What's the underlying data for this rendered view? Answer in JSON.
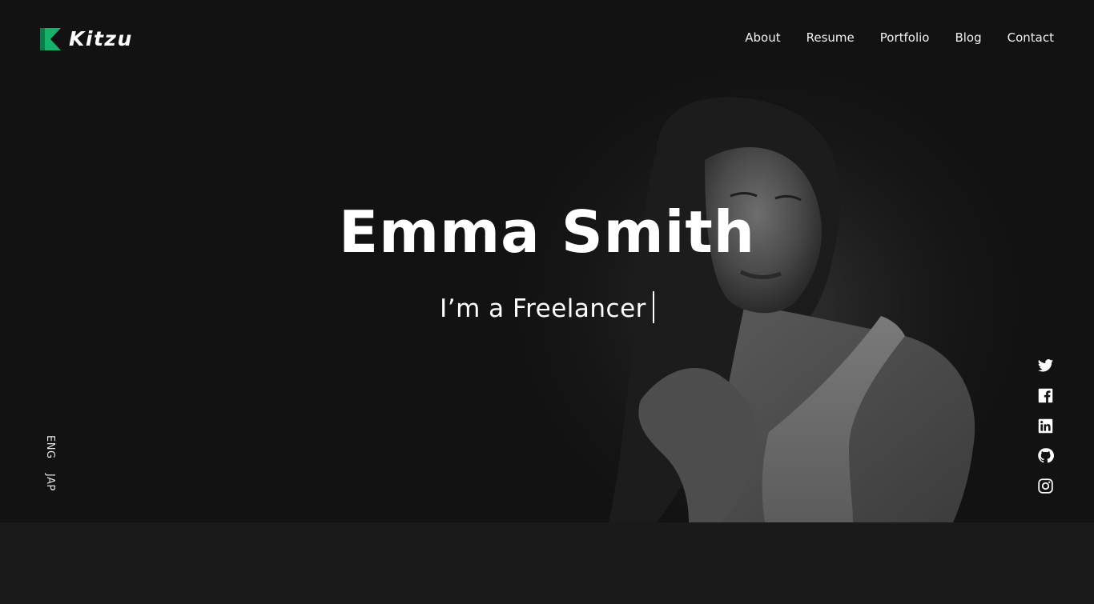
{
  "brand": {
    "name": "Kitzu",
    "accent_color": "#12b36b",
    "accent_dark": "#0c7a49",
    "logo_icon": "k-logo-icon"
  },
  "nav": {
    "items": [
      {
        "label": "About"
      },
      {
        "label": "Resume"
      },
      {
        "label": "Portfolio"
      },
      {
        "label": "Blog"
      },
      {
        "label": "Contact"
      }
    ]
  },
  "hero": {
    "name": "Emma Smith",
    "subtitle": "I’m a Freelancer",
    "background_color": "#121212"
  },
  "languages": [
    {
      "label": "ENG"
    },
    {
      "label": "JAP"
    }
  ],
  "social": [
    {
      "icon": "twitter-icon"
    },
    {
      "icon": "facebook-icon"
    },
    {
      "icon": "linkedin-icon"
    },
    {
      "icon": "github-icon"
    },
    {
      "icon": "instagram-icon"
    }
  ]
}
